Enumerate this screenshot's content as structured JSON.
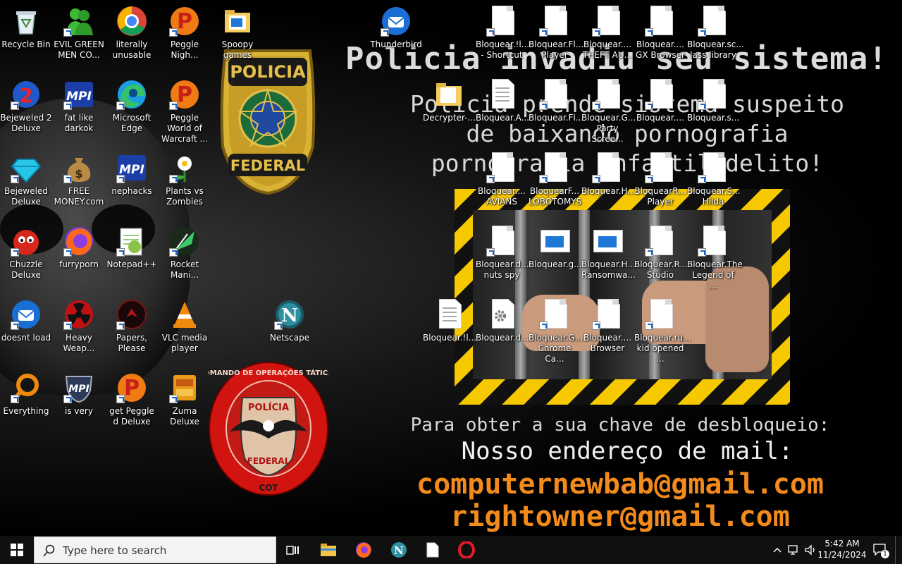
{
  "wallpaper": {
    "headline": "Policia invadiu seu sistema!",
    "subline_1": "Policia prende sistema suspeito",
    "subline_2": "de baixando pornografia",
    "subline_3": "pornografia infantil delito!",
    "unlock_prompt": "Para obter a sua chave de desbloqueio:",
    "mail_heading": "Nosso endereço de mail:",
    "email_1": "computernewbab@gmail.com",
    "email_2": "rightowner@gmail.com",
    "badge_federal_top": "POLICIA",
    "badge_federal_bottom": "FEDERAL",
    "badge_cot_ring": "COMANDO DE OPERAÇÕES TÁTICAS",
    "badge_cot_top": "POLÍCIA",
    "badge_cot_bottom": "FEDERAL",
    "badge_cot_code": "COT"
  },
  "desktop_icons": [
    {
      "label": "Recycle Bin",
      "icon": "recycle-bin-icon"
    },
    {
      "label": "EVIL GREEN MEN CO...",
      "icon": "green-men-icon"
    },
    {
      "label": "literally unusable",
      "icon": "chrome-icon"
    },
    {
      "label": "Peggle Nigh...",
      "icon": "peggle-icon"
    },
    {
      "label": "Spoopy games",
      "icon": "folder-icon"
    },
    {
      "label": "Thunderbird",
      "icon": "thunderbird-icon"
    },
    {
      "label": "Bejeweled 2 Deluxe",
      "icon": "bejeweled2-icon"
    },
    {
      "label": "fat like darkok",
      "icon": "mpi-icon"
    },
    {
      "label": "Microsoft Edge",
      "icon": "edge-icon"
    },
    {
      "label": "Peggle World of Warcraft ...",
      "icon": "peggle-icon"
    },
    {
      "label": "Bejeweled Deluxe",
      "icon": "diamond-icon"
    },
    {
      "label": "FREE MONEY.com",
      "icon": "money-bag-icon"
    },
    {
      "label": "nephacks",
      "icon": "mpi-icon"
    },
    {
      "label": "Plants vs Zombies",
      "icon": "plant-icon"
    },
    {
      "label": "Chuzzle Deluxe",
      "icon": "chuzzle-icon"
    },
    {
      "label": "furryporn",
      "icon": "firefox-icon"
    },
    {
      "label": "Notepad++",
      "icon": "notepad-plus-icon"
    },
    {
      "label": "Rocket Mani...",
      "icon": "rocket-icon"
    },
    {
      "label": "doesnt load",
      "icon": "thunderbird-icon"
    },
    {
      "label": "Heavy Weap...",
      "icon": "radiation-icon"
    },
    {
      "label": "Papers, Please",
      "icon": "papers-please-icon"
    },
    {
      "label": "VLC media player",
      "icon": "vlc-icon"
    },
    {
      "label": "Netscape",
      "icon": "netscape-icon"
    },
    {
      "label": "Everything",
      "icon": "magnifier-icon"
    },
    {
      "label": "is very",
      "icon": "mpi-shield-icon"
    },
    {
      "label": "get Peggle d Deluxe",
      "icon": "peggle-icon"
    },
    {
      "label": "Zuma Deluxe",
      "icon": "zuma-icon"
    }
  ],
  "file_icons": [
    {
      "label": "Bloquear.!l... - Shortcut",
      "type": "doc"
    },
    {
      "label": "Bloquear.Fl... Player",
      "type": "doc"
    },
    {
      "label": "Bloquear.... THEFT AU...",
      "type": "doc"
    },
    {
      "label": "Bloquear.... GX Browser",
      "type": "doc"
    },
    {
      "label": "Bloquear.sc... lass library",
      "type": "doc"
    },
    {
      "label": "Decrypter-...",
      "type": "folder"
    },
    {
      "label": "Bloquear.A...",
      "type": "text"
    },
    {
      "label": "Bloquear.Fl...",
      "type": "doc"
    },
    {
      "label": "Bloquear.G... Party Scree...",
      "type": "doc"
    },
    {
      "label": "Bloquear....",
      "type": "doc"
    },
    {
      "label": "Bloquear.s...",
      "type": "doc"
    },
    {
      "label": "Bloquear.... AVIANS",
      "type": "doc"
    },
    {
      "label": "BloquearF... LOBOTOMYS",
      "type": "doc"
    },
    {
      "label": "Bloquear.H...",
      "type": "doc"
    },
    {
      "label": "BloquearR... Player",
      "type": "doc"
    },
    {
      "label": "Bloquear.S... Hilda",
      "type": "doc"
    },
    {
      "label": "Bloquear.d... nuts spy",
      "type": "doc"
    },
    {
      "label": "Bloquear.g...",
      "type": "app"
    },
    {
      "label": "Bloquear.H... Ransomwa...",
      "type": "app"
    },
    {
      "label": "Bloquear.R... Studio",
      "type": "doc"
    },
    {
      "label": "Bloquear.The Legend of ...",
      "type": "doc"
    },
    {
      "label": "Bloquear.!l...",
      "type": "text"
    },
    {
      "label": "Bloquear.d...",
      "type": "gear"
    },
    {
      "label": "Bloquear.G... Chrome Ca...",
      "type": "doc"
    },
    {
      "label": "Bloquear.... Browser",
      "type": "doc"
    },
    {
      "label": "Bloquear.ru... kid opened ...",
      "type": "doc"
    }
  ],
  "taskbar": {
    "search_placeholder": "Type here to search",
    "pinned": [
      "task-view-icon",
      "file-explorer-icon",
      "firefox-icon",
      "netscape-icon",
      "file-icon",
      "opera-icon"
    ],
    "time": "5:42 AM",
    "date": "11/24/2024",
    "notification_count": "1"
  }
}
